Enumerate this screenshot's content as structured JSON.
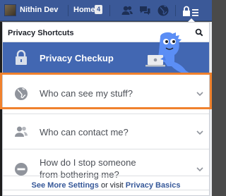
{
  "topbar": {
    "username": "Nithin Dev",
    "home_label": "Home",
    "home_count": "4",
    "icons": [
      "friend-requests-icon",
      "messages-icon",
      "notifications-globe-icon",
      "privacy-shortcuts-icon"
    ]
  },
  "panel": {
    "title": "Privacy Shortcuts",
    "checkup_label": "Privacy Checkup",
    "items": [
      {
        "label": "Who can see my stuff?",
        "icon": "globe-icon"
      },
      {
        "label": "Who can contact me?",
        "icon": "people-icon"
      },
      {
        "label_line1": "How do I stop someone",
        "label_line2": "from bothering me?",
        "icon": "block-icon"
      }
    ],
    "footer": {
      "see_more": "See More Settings",
      "middle": " or visit ",
      "basics": "Privacy Basics"
    }
  },
  "colors": {
    "topbar": "#3b5998",
    "checkup_bg": "#4267b2",
    "highlight": "#f0812d",
    "link": "#365899"
  }
}
